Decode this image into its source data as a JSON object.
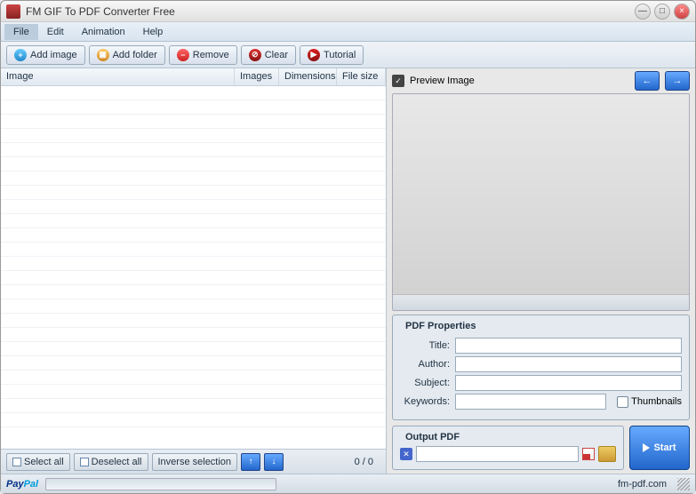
{
  "title": "FM GIF To PDF Converter Free",
  "menu": {
    "file": "File",
    "edit": "Edit",
    "animation": "Animation",
    "help": "Help"
  },
  "toolbar": {
    "add_image": "Add image",
    "add_folder": "Add folder",
    "remove": "Remove",
    "clear": "Clear",
    "tutorial": "Tutorial"
  },
  "table": {
    "col_image": "Image",
    "col_images": "Images",
    "col_dimensions": "Dimensions",
    "col_filesize": "File size"
  },
  "selection": {
    "select_all": "Select all",
    "deselect_all": "Deselect all",
    "inverse": "Inverse selection"
  },
  "counter": "0 / 0",
  "preview": {
    "label": "Preview Image"
  },
  "pdf_props": {
    "legend": "PDF Properties",
    "title_label": "Title:",
    "title_value": "",
    "author_label": "Author:",
    "author_value": "",
    "subject_label": "Subject:",
    "subject_value": "",
    "keywords_label": "Keywords:",
    "keywords_value": "",
    "thumbnails": "Thumbnails"
  },
  "output": {
    "legend": "Output PDF",
    "path": ""
  },
  "start": "Start",
  "status": {
    "paypal1": "Pay",
    "paypal2": "Pal",
    "link": "fm-pdf.com"
  }
}
